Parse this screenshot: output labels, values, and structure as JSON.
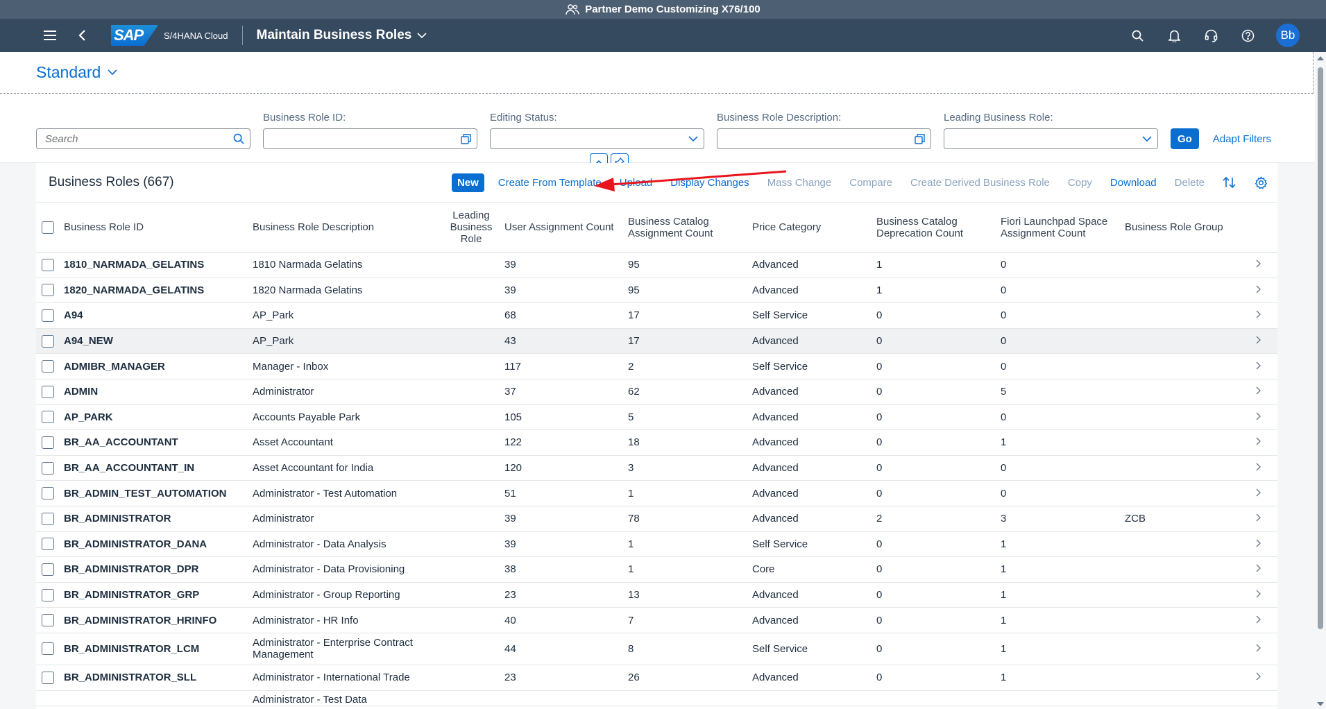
{
  "system": {
    "title": "Partner Demo Customizing  X76/100"
  },
  "shell": {
    "product": "S/4HANA Cloud",
    "logo_text": "SAP",
    "app_title": "Maintain Business Roles",
    "avatar_initials": "Bb"
  },
  "variant": {
    "name": "Standard"
  },
  "filters": {
    "search_placeholder": "Search",
    "business_role_id_label": "Business Role ID:",
    "editing_status_label": "Editing Status:",
    "description_label": "Business Role Description:",
    "leading_role_label": "Leading Business Role:",
    "go_label": "Go",
    "adapt_label": "Adapt Filters"
  },
  "table": {
    "title": "Business Roles (667)",
    "actions": {
      "new": "New",
      "create_from_template": "Create From Template",
      "upload": "Upload",
      "display_changes": "Display Changes",
      "mass_change": "Mass Change",
      "compare": "Compare",
      "create_derived": "Create Derived Business Role",
      "copy": "Copy",
      "download": "Download",
      "delete": "Delete"
    },
    "columns": {
      "id": "Business Role ID",
      "description": "Business Role Description",
      "leading": "Leading Business Role",
      "user_count": "User Assignment Count",
      "catalog_count": "Business Catalog Assignment Count",
      "price": "Price Category",
      "deprecation": "Business Catalog Deprecation Count",
      "space": "Fiori Launchpad Space Assignment Count",
      "group": "Business Role Group"
    },
    "rows": [
      [
        "1810_NARMADA_GELATINS",
        "1810 Narmada Gelatins",
        "39",
        "95",
        "Advanced",
        "1",
        "0",
        ""
      ],
      [
        "1820_NARMADA_GELATINS",
        "1820 Narmada Gelatins",
        "39",
        "95",
        "Advanced",
        "1",
        "0",
        ""
      ],
      [
        "A94",
        "AP_Park",
        "68",
        "17",
        "Self Service",
        "0",
        "0",
        ""
      ],
      [
        "A94_NEW",
        "AP_Park",
        "43",
        "17",
        "Advanced",
        "0",
        "0",
        ""
      ],
      [
        "ADMIBR_MANAGER",
        "Manager - Inbox",
        "117",
        "2",
        "Self Service",
        "0",
        "0",
        ""
      ],
      [
        "ADMIN",
        "Administrator",
        "37",
        "62",
        "Advanced",
        "0",
        "5",
        ""
      ],
      [
        "AP_PARK",
        "Accounts Payable Park",
        "105",
        "5",
        "Advanced",
        "0",
        "0",
        ""
      ],
      [
        "BR_AA_ACCOUNTANT",
        "Asset Accountant",
        "122",
        "18",
        "Advanced",
        "0",
        "1",
        ""
      ],
      [
        "BR_AA_ACCOUNTANT_IN",
        "Asset Accountant for India",
        "120",
        "3",
        "Advanced",
        "0",
        "0",
        ""
      ],
      [
        "BR_ADMIN_TEST_AUTOMATION",
        "Administrator - Test Automation",
        "51",
        "1",
        "Advanced",
        "0",
        "0",
        ""
      ],
      [
        "BR_ADMINISTRATOR",
        "Administrator",
        "39",
        "78",
        "Advanced",
        "2",
        "3",
        "ZCB"
      ],
      [
        "BR_ADMINISTRATOR_DANA",
        "Administrator - Data Analysis",
        "39",
        "1",
        "Self Service",
        "0",
        "1",
        ""
      ],
      [
        "BR_ADMINISTRATOR_DPR",
        "Administrator - Data Provisioning",
        "38",
        "1",
        "Core",
        "0",
        "1",
        ""
      ],
      [
        "BR_ADMINISTRATOR_GRP",
        "Administrator - Group Reporting",
        "23",
        "13",
        "Advanced",
        "0",
        "1",
        ""
      ],
      [
        "BR_ADMINISTRATOR_HRINFO",
        "Administrator - HR Info",
        "40",
        "7",
        "Advanced",
        "0",
        "1",
        ""
      ],
      [
        "BR_ADMINISTRATOR_LCM",
        "Administrator - Enterprise Contract Management",
        "44",
        "8",
        "Self Service",
        "0",
        "1",
        ""
      ],
      [
        "BR_ADMINISTRATOR_SLL",
        "Administrator - International Trade",
        "23",
        "26",
        "Advanced",
        "0",
        "1",
        ""
      ]
    ],
    "partial_row_description": "Administrator - Test Data"
  },
  "colors": {
    "accent": "#0a6ed1",
    "shell": "#354a5f",
    "annotation_arrow": "#e8161c"
  }
}
